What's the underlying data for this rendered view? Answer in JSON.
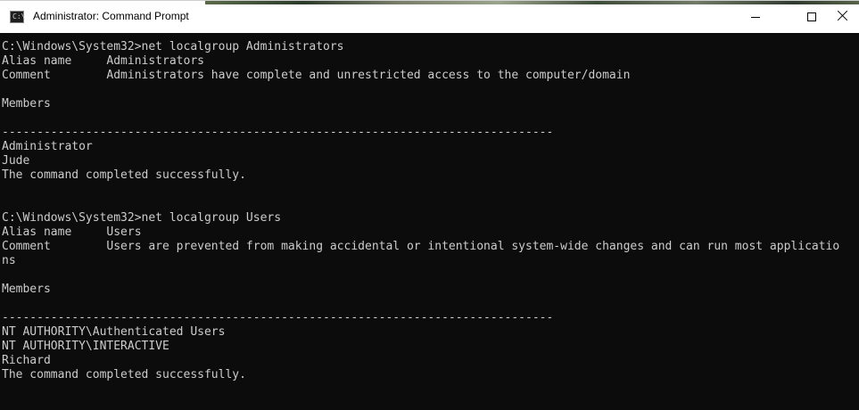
{
  "window": {
    "title": "Administrator: Command Prompt",
    "icon": "cmd-icon",
    "controls": [
      "minimize-icon",
      "maximize-icon",
      "close-icon"
    ]
  },
  "colors": {
    "console_bg": "#0c0c0c",
    "console_text": "#cccccc",
    "titlebar_bg": "#ffffff"
  },
  "console": {
    "lines": [
      "C:\\Windows\\System32>net localgroup Administrators",
      "Alias name     Administrators",
      "Comment        Administrators have complete and unrestricted access to the computer/domain",
      "",
      "Members",
      "",
      "-------------------------------------------------------------------------------",
      "Administrator",
      "Jude",
      "The command completed successfully.",
      "",
      "",
      "C:\\Windows\\System32>net localgroup Users",
      "Alias name     Users",
      "Comment        Users are prevented from making accidental or intentional system-wide changes and can run most applicatio",
      "ns",
      "",
      "Members",
      "",
      "-------------------------------------------------------------------------------",
      "NT AUTHORITY\\Authenticated Users",
      "NT AUTHORITY\\INTERACTIVE",
      "Richard",
      "The command completed successfully."
    ]
  }
}
